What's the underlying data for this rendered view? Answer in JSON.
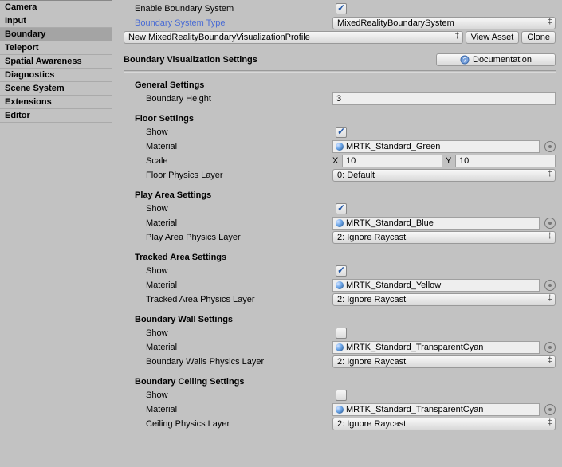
{
  "sidebar": {
    "items": [
      {
        "label": "Camera"
      },
      {
        "label": "Input"
      },
      {
        "label": "Boundary",
        "selected": true
      },
      {
        "label": "Teleport"
      },
      {
        "label": "Spatial Awareness"
      },
      {
        "label": "Diagnostics"
      },
      {
        "label": "Scene System"
      },
      {
        "label": "Extensions"
      },
      {
        "label": "Editor"
      }
    ]
  },
  "top": {
    "enable_label": "Enable Boundary System",
    "enable_checked": true,
    "systype_label": "Boundary System Type",
    "systype_value": "MixedRealityBoundarySystem",
    "profile_value": "New MixedRealityBoundaryVisualizationProfile",
    "view_asset_label": "View Asset",
    "clone_label": "Clone"
  },
  "vis": {
    "header": "Boundary Visualization Settings",
    "doc_label": "Documentation"
  },
  "general": {
    "header": "General Settings",
    "height_label": "Boundary Height",
    "height_value": "3"
  },
  "floor": {
    "header": "Floor Settings",
    "show_label": "Show",
    "show_checked": true,
    "material_label": "Material",
    "material_value": "MRTK_Standard_Green",
    "scale_label": "Scale",
    "scale_x": "10",
    "scale_y": "10",
    "layer_label": "Floor Physics Layer",
    "layer_value": "0: Default"
  },
  "play": {
    "header": "Play Area Settings",
    "show_label": "Show",
    "show_checked": true,
    "material_label": "Material",
    "material_value": "MRTK_Standard_Blue",
    "layer_label": "Play Area Physics Layer",
    "layer_value": "2: Ignore Raycast"
  },
  "tracked": {
    "header": "Tracked Area Settings",
    "show_label": "Show",
    "show_checked": true,
    "material_label": "Material",
    "material_value": "MRTK_Standard_Yellow",
    "layer_label": "Tracked Area Physics Layer",
    "layer_value": "2: Ignore Raycast"
  },
  "wall": {
    "header": "Boundary Wall Settings",
    "show_label": "Show",
    "show_checked": false,
    "material_label": "Material",
    "material_value": "MRTK_Standard_TransparentCyan",
    "layer_label": "Boundary Walls Physics Layer",
    "layer_value": "2: Ignore Raycast"
  },
  "ceiling": {
    "header": "Boundary Ceiling Settings",
    "show_label": "Show",
    "show_checked": false,
    "material_label": "Material",
    "material_value": "MRTK_Standard_TransparentCyan",
    "layer_label": "Ceiling Physics Layer",
    "layer_value": "2: Ignore Raycast"
  }
}
